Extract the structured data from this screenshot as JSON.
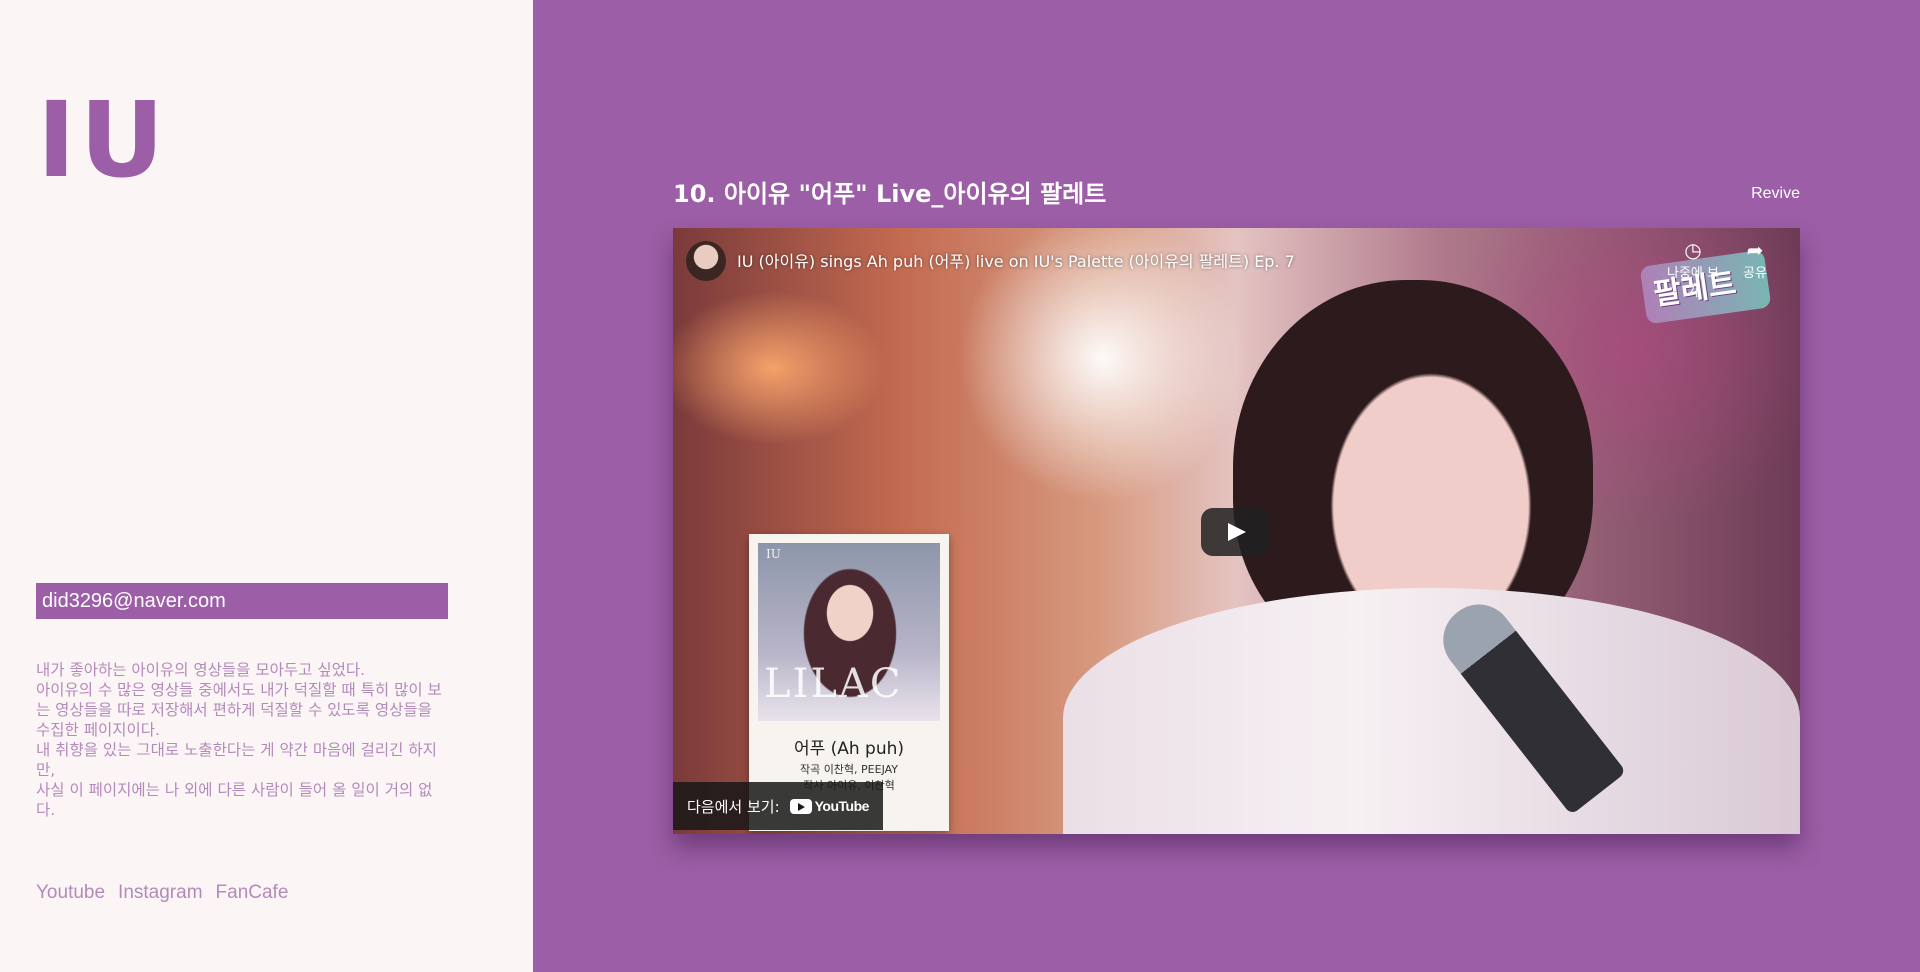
{
  "sidebar": {
    "logo": "IU",
    "email": "did3296@naver.com",
    "intro": [
      "내가 좋아하는 아이유의 영상들을 모아두고 싶었다.",
      "아이유의 수 많은 영상들 중에서도 내가 덕질할 때 특히 많이 보는 영상들을 따로 저장해서 편하게 덕질할 수 있도록 영상들을 수집한 페이지이다.",
      "내 취향을 있는 그대로 노출한다는 게 약간 마음에 걸리긴 하지만,",
      "사실 이 페이지에는 나 외에 다른 사람이 들어 올 일이 거의 없다."
    ],
    "links": [
      "Youtube",
      "Instagram",
      "FanCafe"
    ]
  },
  "main": {
    "title": "10. 아이유 \"어푸\" Live_아이유의 팔레트",
    "revive_label": "Revive",
    "video": {
      "title": "IU (아이유) sings Ah puh (어푸) live on IU's Palette (아이유의 팔레트) Ep. 7",
      "watch_later_label": "나중에 보기",
      "share_label": "공유",
      "show_logo_text": "팔레트",
      "album_artist": "IU",
      "album_name": "LILAC",
      "album_song": "어푸 (Ah puh)",
      "album_credits": "작곡 이찬혁, PEEJAY",
      "album_credits_2": "작사 아이유, 이찬혁",
      "watch_on_label": "다음에서 보기:",
      "youtube_label": "YouTube"
    }
  },
  "colors": {
    "accent": "#9c5ea6",
    "sidebar_bg": "#fbf6f5",
    "muted_text": "#b489bb"
  }
}
